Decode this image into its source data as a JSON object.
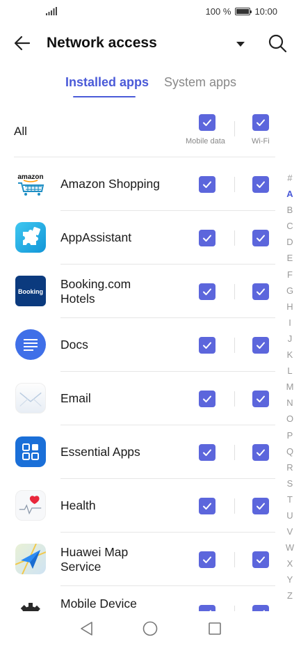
{
  "status": {
    "battery": "100 %",
    "time": "10:00"
  },
  "header": {
    "title": "Network access"
  },
  "tabs": [
    {
      "label": "Installed apps",
      "active": true
    },
    {
      "label": "System apps",
      "active": false
    }
  ],
  "columns": {
    "all_label": "All",
    "mobile_data": "Mobile data",
    "wifi": "Wi-Fi"
  },
  "apps": [
    {
      "name": "Amazon Shopping",
      "icon": "amazon-shopping-icon",
      "mobile_data": true,
      "wifi": true
    },
    {
      "name": "AppAssistant",
      "icon": "app-assistant-icon",
      "mobile_data": true,
      "wifi": true
    },
    {
      "name": "Booking.com Hotels",
      "icon": "booking-icon",
      "mobile_data": true,
      "wifi": true
    },
    {
      "name": "Docs",
      "icon": "docs-icon",
      "mobile_data": true,
      "wifi": true
    },
    {
      "name": "Email",
      "icon": "email-icon",
      "mobile_data": true,
      "wifi": true
    },
    {
      "name": "Essential Apps",
      "icon": "essential-apps-icon",
      "mobile_data": true,
      "wifi": true
    },
    {
      "name": "Health",
      "icon": "health-icon",
      "mobile_data": true,
      "wifi": true
    },
    {
      "name": "Huawei Map Service",
      "icon": "map-service-icon",
      "mobile_data": true,
      "wifi": true
    },
    {
      "name": "Mobile Device",
      "icon": "mobile-device-icon",
      "mobile_data": true,
      "wifi": true
    }
  ],
  "icon_text": {
    "amazon": "amazon",
    "booking": "Booking"
  },
  "index": [
    "#",
    "A",
    "B",
    "C",
    "D",
    "E",
    "F",
    "G",
    "H",
    "I",
    "J",
    "K",
    "L",
    "M",
    "N",
    "O",
    "P",
    "Q",
    "R",
    "S",
    "T",
    "U",
    "V",
    "W",
    "X",
    "Y",
    "Z"
  ],
  "index_active": "A",
  "colors": {
    "accent": "#4a5ad8",
    "checkbox": "#5c66dc"
  }
}
